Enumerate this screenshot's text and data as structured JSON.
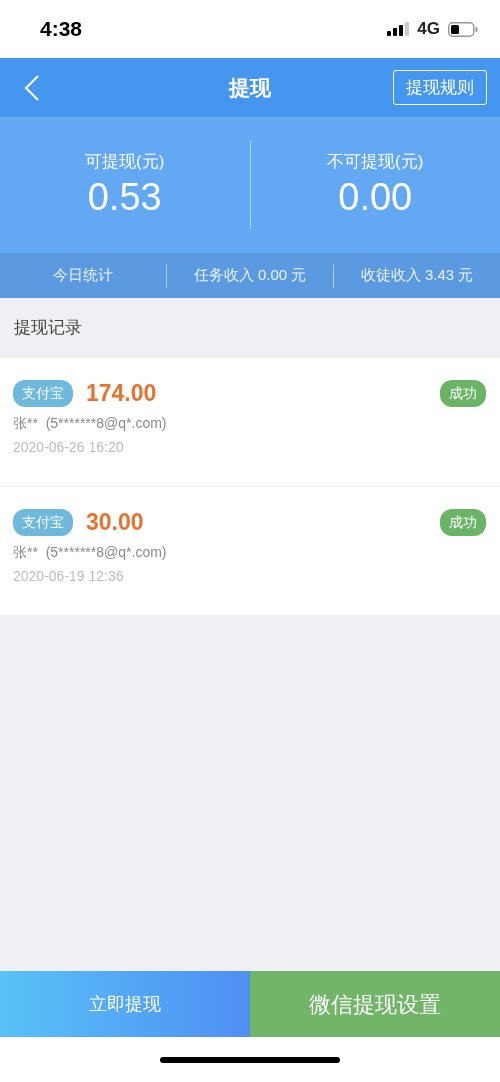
{
  "status_bar": {
    "time": "4:38",
    "network": "4G"
  },
  "nav": {
    "title": "提现",
    "action": "提现规则"
  },
  "balances": [
    {
      "label": "可提现(元)",
      "amount": "0.53"
    },
    {
      "label": "不可提现(元)",
      "amount": "0.00"
    }
  ],
  "stats": [
    "今日统计",
    "任务收入 0.00 元",
    "收徒收入 3.43 元"
  ],
  "records_title": "提现记录",
  "records": [
    {
      "method": "支付宝",
      "amount": "174.00",
      "status": "成功",
      "account": "张**  (5*******8@q*.com)",
      "time": "2020-06-26 16:20"
    },
    {
      "method": "支付宝",
      "amount": "30.00",
      "status": "成功",
      "account": "张**  (5*******8@q*.com)",
      "time": "2020-06-19 12:36"
    }
  ],
  "buttons": [
    {
      "label": "立即提现",
      "kind": "primary"
    },
    {
      "label": "微信提现设置",
      "kind": "wechat"
    }
  ]
}
